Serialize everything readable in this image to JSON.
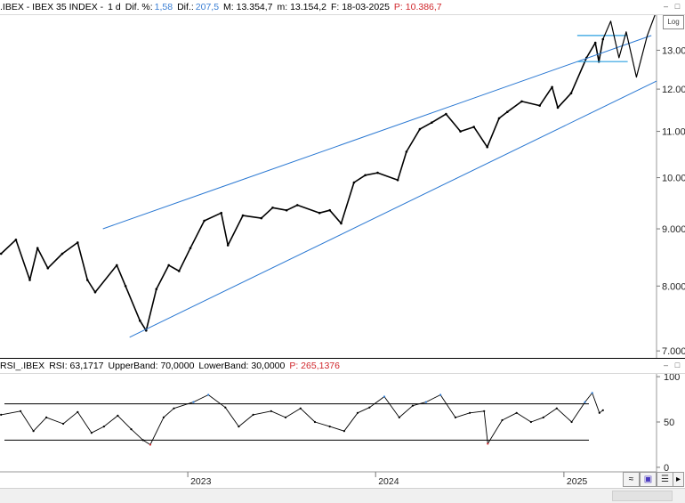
{
  "header": {
    "symbol": ".IBEX - IBEX 35 INDEX -",
    "interval": "1 d",
    "dif_pct_label": "Dif. %:",
    "dif_pct_value": "1,58",
    "dif_label": "Dif.:",
    "dif_value": "207,5",
    "max": "M: 13.354,7",
    "min": "m: 13.154,2",
    "date": "F: 18-03-2025",
    "last": "P: 10.386,7"
  },
  "rsi_header": {
    "name": "RSI_.IBEX",
    "rsi": "RSI: 63,1717",
    "upper": "UpperBand: 70,0000",
    "lower": "LowerBand: 30,0000",
    "last": "P: 265,1376"
  },
  "log_button": "Log",
  "chart_data": [
    {
      "type": "line",
      "title": ".IBEX - IBEX 35 INDEX - 1 d",
      "y_axis_ticks": [
        "7.000",
        "8.000",
        "9.000",
        "10.000",
        "11.000",
        "12.000",
        "13.000"
      ],
      "ylim": [
        6900,
        14000
      ],
      "y_scale": "log",
      "x_axis_ticks": [
        "2023",
        "2024",
        "2025"
      ],
      "x_range": [
        "2022-01-01",
        "2025-06-30"
      ],
      "series": [
        {
          "x": [
            "2022-01-03",
            "2022-02-01",
            "2022-02-28",
            "2022-03-15",
            "2022-04-04",
            "2022-05-02",
            "2022-06-01",
            "2022-06-20",
            "2022-07-05",
            "2022-08-16",
            "2022-09-02",
            "2022-09-30",
            "2022-10-12",
            "2022-11-01",
            "2022-11-25",
            "2022-12-15",
            "2023-01-06",
            "2023-02-02",
            "2023-03-07",
            "2023-03-20",
            "2023-04-18",
            "2023-05-24",
            "2023-06-15",
            "2023-07-12",
            "2023-08-02",
            "2023-09-14",
            "2023-10-04",
            "2023-10-26",
            "2023-11-20",
            "2023-12-12",
            "2024-01-05",
            "2024-02-13",
            "2024-03-01",
            "2024-03-27",
            "2024-04-19",
            "2024-05-17",
            "2024-06-14",
            "2024-07-10",
            "2024-08-05",
            "2024-08-28",
            "2024-09-13",
            "2024-10-11",
            "2024-11-15",
            "2024-12-09",
            "2024-12-20",
            "2025-01-15",
            "2025-02-14",
            "2025-03-03",
            "2025-03-10",
            "2025-03-18"
          ],
          "y": [
            8550,
            8800,
            8100,
            8650,
            8300,
            8550,
            8750,
            8100,
            7900,
            8350,
            8000,
            7450,
            7300,
            7950,
            8350,
            8250,
            8650,
            9150,
            9300,
            8700,
            9250,
            9200,
            9400,
            9350,
            9450,
            9300,
            9350,
            9100,
            9900,
            10050,
            10100,
            9950,
            10550,
            11050,
            11200,
            11400,
            11000,
            11100,
            10650,
            11300,
            11450,
            11700,
            11600,
            12050,
            11550,
            11900,
            12800,
            13200,
            12700,
            13300
          ]
        },
        {
          "name": "Channel upper",
          "x": [
            "2022-07-20",
            "2025-06-20"
          ],
          "y": [
            9000,
            13400
          ]
        },
        {
          "name": "Channel lower",
          "x": [
            "2022-09-10",
            "2025-06-30"
          ],
          "y": [
            7200,
            12200
          ]
        },
        {
          "name": "Box top",
          "x": [
            "2025-01-27",
            "2025-05-05"
          ],
          "y": [
            13400,
            13400
          ]
        },
        {
          "name": "Box bottom",
          "x": [
            "2025-01-27",
            "2025-05-05"
          ],
          "y": [
            12700,
            12700
          ]
        },
        {
          "name": "Projection",
          "x": [
            "2025-03-18",
            "2025-04-02",
            "2025-04-18",
            "2025-05-02",
            "2025-05-22",
            "2025-06-12",
            "2025-06-30"
          ],
          "y": [
            13300,
            13800,
            12800,
            13500,
            12300,
            13400,
            14100
          ]
        }
      ]
    },
    {
      "type": "line",
      "title": "RSI_.IBEX",
      "y_axis_ticks": [
        "0",
        "50",
        "100"
      ],
      "ylim": [
        -5,
        105
      ],
      "bands": [
        70,
        30
      ],
      "x_range": [
        "2022-01-01",
        "2025-06-30"
      ],
      "series": [
        {
          "x": [
            "2022-01-03",
            "2022-02-10",
            "2022-03-07",
            "2022-04-01",
            "2022-05-04",
            "2022-06-01",
            "2022-06-28",
            "2022-07-22",
            "2022-08-18",
            "2022-09-13",
            "2022-10-06",
            "2022-10-20",
            "2022-11-15",
            "2022-12-05",
            "2023-01-12",
            "2023-02-10",
            "2023-03-15",
            "2023-04-10",
            "2023-05-08",
            "2023-06-12",
            "2023-07-10",
            "2023-08-08",
            "2023-09-05",
            "2023-10-04",
            "2023-11-01",
            "2023-11-27",
            "2023-12-20",
            "2024-01-18",
            "2024-02-16",
            "2024-03-13",
            "2024-04-08",
            "2024-05-06",
            "2024-06-04",
            "2024-07-02",
            "2024-07-30",
            "2024-08-06",
            "2024-09-03",
            "2024-10-01",
            "2024-10-29",
            "2024-11-22",
            "2024-12-18",
            "2025-01-16",
            "2025-02-11",
            "2025-02-25",
            "2025-03-11",
            "2025-03-18"
          ],
          "y": [
            58,
            62,
            40,
            55,
            48,
            61,
            38,
            45,
            57,
            42,
            30,
            25,
            55,
            65,
            72,
            80,
            66,
            45,
            58,
            62,
            55,
            65,
            50,
            45,
            40,
            60,
            66,
            78,
            55,
            68,
            72,
            80,
            55,
            60,
            62,
            26,
            52,
            60,
            50,
            55,
            65,
            50,
            72,
            82,
            60,
            63
          ]
        }
      ]
    }
  ]
}
